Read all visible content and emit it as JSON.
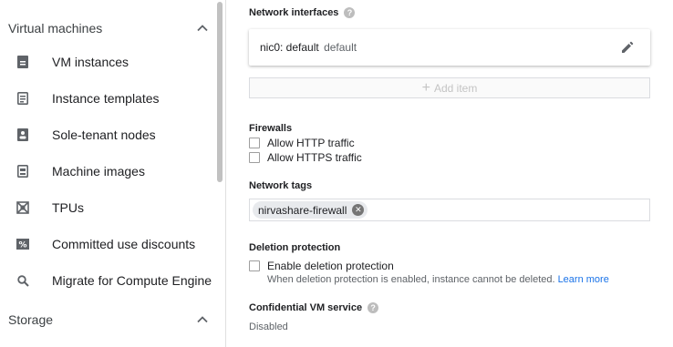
{
  "sidebar": {
    "section_vm": "Virtual machines",
    "items": [
      {
        "label": "VM instances",
        "icon": "vm-instances-icon"
      },
      {
        "label": "Instance templates",
        "icon": "instance-templates-icon"
      },
      {
        "label": "Sole-tenant nodes",
        "icon": "sole-tenant-icon"
      },
      {
        "label": "Machine images",
        "icon": "machine-images-icon"
      },
      {
        "label": "TPUs",
        "icon": "tpu-icon"
      },
      {
        "label": "Committed use discounts",
        "icon": "percent-icon"
      },
      {
        "label": "Migrate for Compute Engine",
        "icon": "search-icon"
      }
    ],
    "section_storage": "Storage"
  },
  "network": {
    "title": "Network interfaces",
    "nic_name": "nic0: default",
    "nic_sub": "default",
    "add_item": "Add item"
  },
  "firewalls": {
    "title": "Firewalls",
    "http": "Allow HTTP traffic",
    "https": "Allow HTTPS traffic"
  },
  "tags": {
    "title": "Network tags",
    "chip": "nirvashare-firewall"
  },
  "deletion": {
    "title": "Deletion protection",
    "checkbox": "Enable deletion protection",
    "help": "When deletion protection is enabled, instance cannot be deleted.",
    "learn_more": "Learn more"
  },
  "confidential": {
    "title": "Confidential VM service",
    "value": "Disabled"
  },
  "colors": {
    "link": "#1a73e8",
    "icon": "#5f6368"
  }
}
